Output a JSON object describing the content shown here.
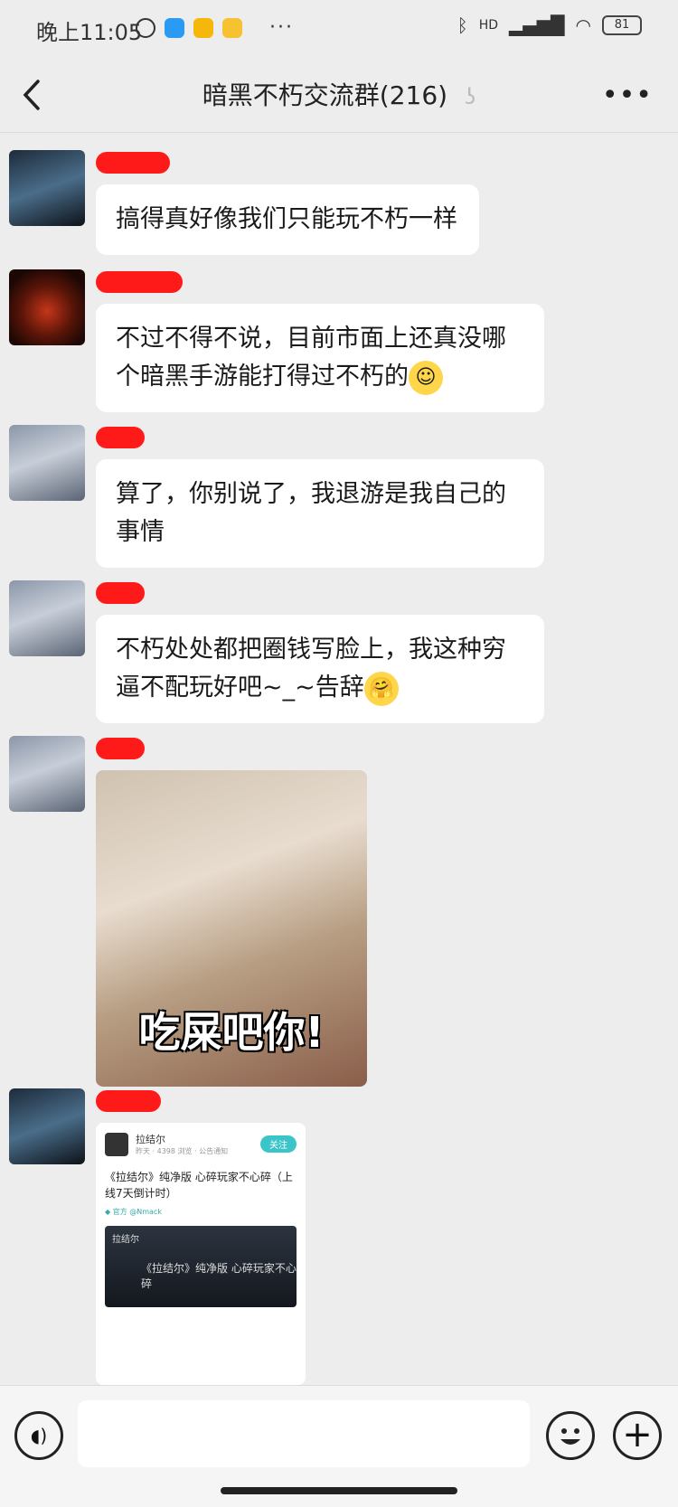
{
  "status": {
    "time": "晚上11:05",
    "network": "HD",
    "battery": "81",
    "overflow": "···"
  },
  "header": {
    "title": "暗黑不朽交流群(216)",
    "back_icon": "chevron-left-icon",
    "more_icon": "more-dots-icon",
    "more": "•••"
  },
  "messages": [
    {
      "text": "搞得真好像我们只能玩不朽一样"
    },
    {
      "text": "不过不得不说，目前市面上还真没哪个暗黑手游能打得过不朽的",
      "emoji": "☺"
    },
    {
      "text": "算了，你别说了，我退游是我自己的事情"
    },
    {
      "text": "不朽处处都把圈钱写脸上，我这种穷逼不配玩好吧~_~告辞",
      "emoji": "🤗"
    },
    {
      "image_caption": "吃屎吧你!"
    },
    {
      "share": {
        "author": "拉结尔",
        "meta": "昨天 · 4398 浏览 · 公告通知",
        "follow": "关注",
        "title": "《拉结尔》纯净版 心碎玩家不心碎（上线7天倒计时）",
        "tag": "◆ 官方 @Nmack",
        "brand": "拉结尔",
        "image_text": "《拉结尔》纯净版 心碎玩家不心碎"
      }
    }
  ],
  "input": {
    "placeholder": ""
  }
}
